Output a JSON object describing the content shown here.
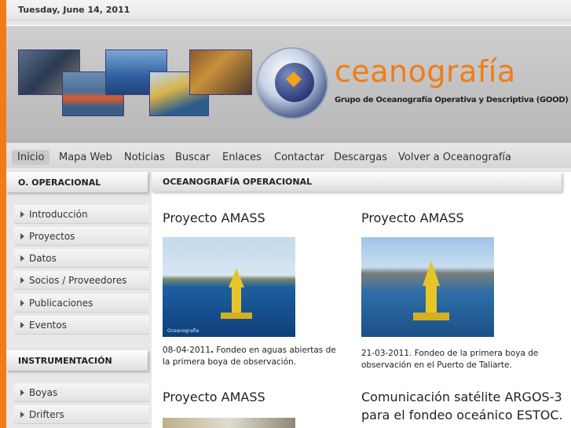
{
  "topbar": {
    "date": "Tuesday, June 14, 2011"
  },
  "logo": {
    "title": "ceanografía",
    "subtitle": "Grupo de Oceanografía Operativa y Descriptiva (GOOD)"
  },
  "nav": {
    "items": [
      "Inicio",
      "Mapa Web",
      "Noticias",
      "Buscar",
      "Enlaces",
      "Contactar",
      "Descargas",
      "Volver a Oceanografía"
    ]
  },
  "sidebar": {
    "section1": {
      "title": "O. OPERACIONAL",
      "items": [
        "Introducción",
        "Proyectos",
        "Datos",
        "Socios / Proveedores",
        "Publicaciones",
        "Eventos"
      ]
    },
    "section2": {
      "title": "INSTRUMENTACIÓN",
      "items": [
        "Boyas",
        "Drifters"
      ]
    }
  },
  "main": {
    "title": "OCEANOGRAFÍA OPERACIONAL",
    "articles": [
      {
        "title": "Proyecto AMASS",
        "date": "08-04-2011",
        "text": "Fondeo en aguas abiertas de la primera boya de observación.",
        "watermark": "Oceanografía"
      },
      {
        "title": "Proyecto AMASS",
        "text": "21-03-2011. Fondeo de la primera boya de observación en el Puerto de Taliarte."
      },
      {
        "title": "Proyecto AMASS"
      },
      {
        "title_line1": "Comunicación satélite ARGOS-3",
        "title_line2": "para el fondeo oceánico ESTOC."
      }
    ]
  },
  "colors": {
    "accent": "#f07c17",
    "logo_blue": "#2c3d7b"
  }
}
